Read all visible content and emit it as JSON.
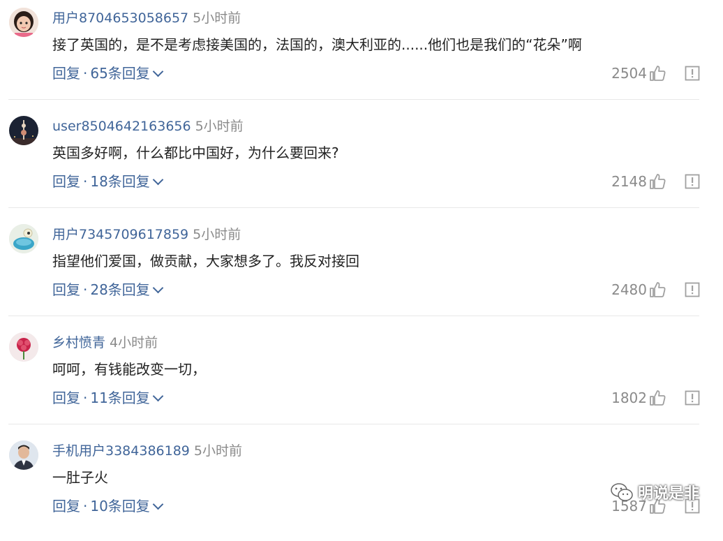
{
  "comments": [
    {
      "username": "用户8704653058657",
      "time": "5小时前",
      "text": "接了英国的，是不是考虑接美国的，法国的，澳大利亚的......他们也是我们的“花朵”啊",
      "reply_label": "回复",
      "replies_label": "65条回复",
      "likes": "2504",
      "avatar": "girl-avatar"
    },
    {
      "username": "user8504642163656",
      "time": "5小时前",
      "text": "英国多好啊，什么都比中国好，为什么要回来?",
      "reply_label": "回复",
      "replies_label": "18条回复",
      "likes": "2148",
      "avatar": "tower-night-avatar"
    },
    {
      "username": "用户7345709617859",
      "time": "5小时前",
      "text": "指望他们爱国，做贡献，大家想多了。我反对接回",
      "reply_label": "回复",
      "replies_label": "28条回复",
      "likes": "2480",
      "avatar": "cartoon-avatar"
    },
    {
      "username": "乡村愤青",
      "time": "4小时前",
      "text": "呵呵，有钱能改变一切，",
      "reply_label": "回复",
      "replies_label": "11条回复",
      "likes": "1802",
      "avatar": "flower-avatar"
    },
    {
      "username": "手机用户3384386189",
      "time": "5小时前",
      "text": "一肚子火",
      "reply_label": "回复",
      "replies_label": "10条回复",
      "likes": "1587",
      "avatar": "man-photo-avatar"
    }
  ],
  "separator": "·",
  "watermark": {
    "text": "明说是非",
    "icon": "wechat-icon"
  },
  "colors": {
    "link": "#406599",
    "muted": "#8a8a8a",
    "text": "#222222",
    "divider": "#e8e8e8"
  }
}
